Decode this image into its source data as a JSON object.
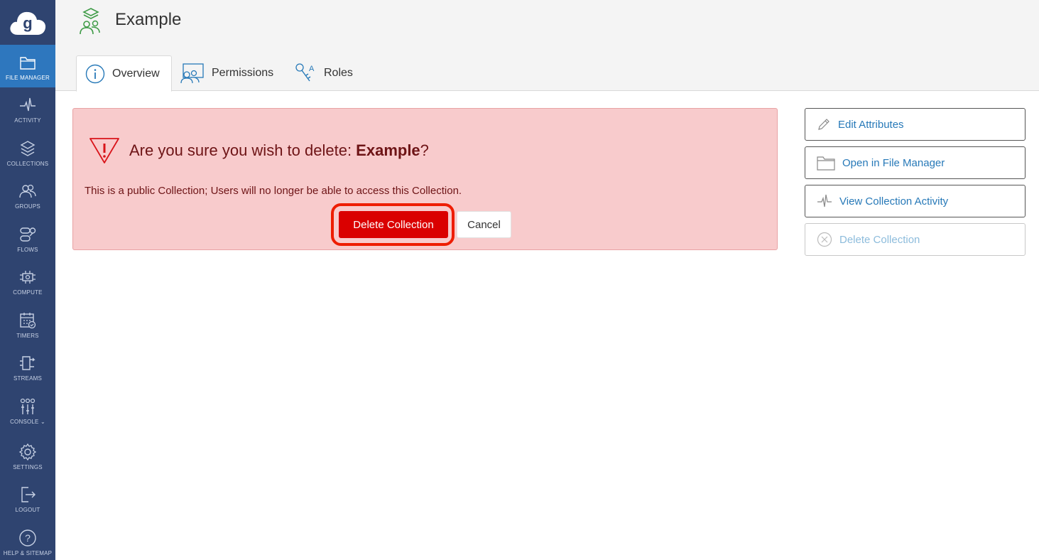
{
  "sidebar": {
    "items": [
      {
        "label": "FILE MANAGER",
        "icon": "folder-icon"
      },
      {
        "label": "ACTIVITY",
        "icon": "activity-icon"
      },
      {
        "label": "COLLECTIONS",
        "icon": "layers-icon"
      },
      {
        "label": "GROUPS",
        "icon": "users-icon"
      },
      {
        "label": "FLOWS",
        "icon": "flows-icon"
      },
      {
        "label": "COMPUTE",
        "icon": "compute-icon"
      },
      {
        "label": "TIMERS",
        "icon": "calendar-icon"
      },
      {
        "label": "STREAMS",
        "icon": "streams-icon"
      },
      {
        "label": "CONSOLE",
        "icon": "sliders-icon"
      },
      {
        "label": "SETTINGS",
        "icon": "gear-icon"
      },
      {
        "label": "LOGOUT",
        "icon": "logout-icon"
      },
      {
        "label": "HELP & SITEMAP",
        "icon": "help-icon"
      }
    ],
    "active_color": "#2e77be",
    "bg_color": "#2f4470"
  },
  "header": {
    "title": "Example",
    "tabs": [
      {
        "label": "Overview",
        "icon": "info-icon"
      },
      {
        "label": "Permissions",
        "icon": "permissions-icon"
      },
      {
        "label": "Roles",
        "icon": "roles-icon"
      }
    ]
  },
  "alert": {
    "question_prefix": "Are you sure you wish to delete: ",
    "question_name": "Example",
    "question_suffix": "?",
    "message": "This is a public Collection; Users will no longer be able to access this Collection.",
    "delete_label": "Delete Collection",
    "cancel_label": "Cancel"
  },
  "actions": [
    {
      "label": "Edit Attributes",
      "icon": "pencil-icon",
      "enabled": true
    },
    {
      "label": "Open in File Manager",
      "icon": "folder-icon",
      "enabled": true
    },
    {
      "label": "View Collection Activity",
      "icon": "activity-icon",
      "enabled": true
    },
    {
      "label": "Delete Collection",
      "icon": "circle-x-icon",
      "enabled": false
    }
  ]
}
